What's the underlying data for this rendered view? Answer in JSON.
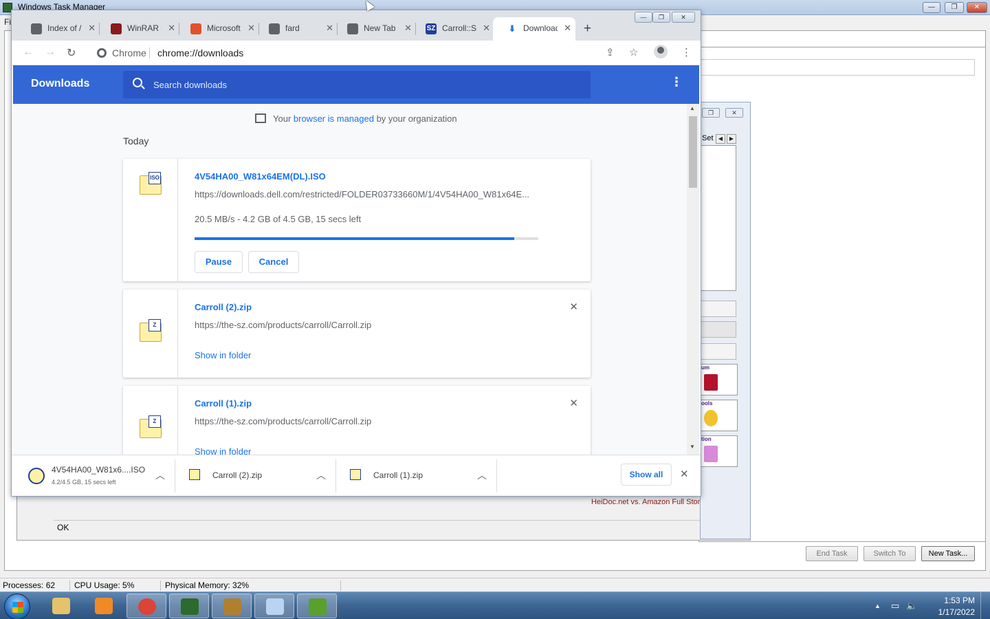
{
  "taskmgr": {
    "title": "Windows Task Manager",
    "menu_label": "Fi",
    "ok_text": "OK",
    "heidoc_text": "HeiDoc.net vs. Amazon Full Story",
    "help_glyph": "?",
    "side_set_label": "Set",
    "side_tiles": [
      "um",
      "ools",
      "tion"
    ],
    "buttons": {
      "end_task": "End Task",
      "switch_to": "Switch To",
      "new_task": "New Task..."
    },
    "status": {
      "processes": "Processes: 62",
      "cpu": "CPU Usage: 5%",
      "memory": "Physical Memory: 32%"
    },
    "window_controls": {
      "minimize": "—",
      "restore": "❐",
      "close": "✕"
    }
  },
  "chrome": {
    "tabs": [
      {
        "label": "Index of /",
        "favicon": "index-favicon",
        "color": "#5f6368",
        "active": false
      },
      {
        "label": "WinRAR d",
        "favicon": "winrar-favicon",
        "color": "#8b1a1a",
        "active": false
      },
      {
        "label": "Microsoft",
        "favicon": "microsoft-favicon",
        "color": "#e0522a",
        "active": false
      },
      {
        "label": "fard",
        "favicon": "globe-favicon",
        "color": "#5f6368",
        "active": false
      },
      {
        "label": "New Tab",
        "favicon": "chrome-favicon",
        "color": "#5f6368",
        "active": false
      },
      {
        "label": "Carroll::Sc",
        "favicon": "sz-favicon",
        "color": "#1f3f9a",
        "active": false
      },
      {
        "label": "Downloads",
        "favicon": "download-favicon",
        "color": "#1a73e8",
        "active": true
      }
    ],
    "tab_close_glyph": "✕",
    "newtab_glyph": "+",
    "window_controls": {
      "minimize": "—",
      "restore": "❐",
      "close": "✕"
    },
    "toolbar": {
      "back": "←",
      "forward": "→",
      "reload": "↻",
      "chip": "Chrome",
      "url": "chrome://downloads",
      "share": "⇪",
      "star": "☆",
      "menu": "⋮"
    }
  },
  "downloads": {
    "title": "Downloads",
    "search_placeholder": "Search downloads",
    "more_glyph": "⋮",
    "managed": {
      "prefix": "Your ",
      "link": "browser is managed",
      "suffix": " by your organization"
    },
    "section": "Today",
    "items": [
      {
        "name": "4V54HA00_W81x64EM(DL).ISO",
        "url": "https://downloads.dell.com/restricted/FOLDER03733660M/1/4V54HA00_W81x64E...",
        "status": "20.5 MB/s - 4.2 GB of 4.5 GB, 15 secs left",
        "progress": 0.93,
        "icon_tag": "ISO",
        "pause": "Pause",
        "cancel": "Cancel"
      },
      {
        "name": "Carroll (2).zip",
        "url": "https://the-sz.com/products/carroll/Carroll.zip",
        "icon_tag": "Z",
        "show_in_folder": "Show in folder",
        "remove": "✕"
      },
      {
        "name": "Carroll (1).zip",
        "url": "https://the-sz.com/products/carroll/Carroll.zip",
        "icon_tag": "Z",
        "show_in_folder": "Show in folder",
        "remove": "✕"
      }
    ],
    "scroll": {
      "up": "▲",
      "down": "▼"
    }
  },
  "shelf": {
    "items": [
      {
        "name": "4V54HA00_W81x6....ISO",
        "sub": "4.2/4.5 GB, 15 secs left",
        "icon_tag": "ISO"
      },
      {
        "name": "Carroll (2).zip",
        "icon_tag": "Z"
      },
      {
        "name": "Carroll (1).zip",
        "icon_tag": "Z"
      }
    ],
    "caret": "︿",
    "show_all": "Show all",
    "close": "✕"
  },
  "taskbar": {
    "apps": [
      {
        "name": "explorer",
        "color": "#e6c36a"
      },
      {
        "name": "media-player",
        "color": "#f08a24"
      },
      {
        "name": "chrome",
        "color": "#db4437"
      },
      {
        "name": "hardware-tool",
        "color": "#2d6a2d"
      },
      {
        "name": "archive-tool",
        "color": "#b08030"
      },
      {
        "name": "paint",
        "color": "#b9d3f0"
      },
      {
        "name": "task-manager",
        "color": "#5aa02c"
      }
    ],
    "tray": {
      "chevron": "▲",
      "network": "▭",
      "volume": "🔈"
    },
    "clock_time": "1:53 PM",
    "clock_date": "1/17/2022"
  }
}
